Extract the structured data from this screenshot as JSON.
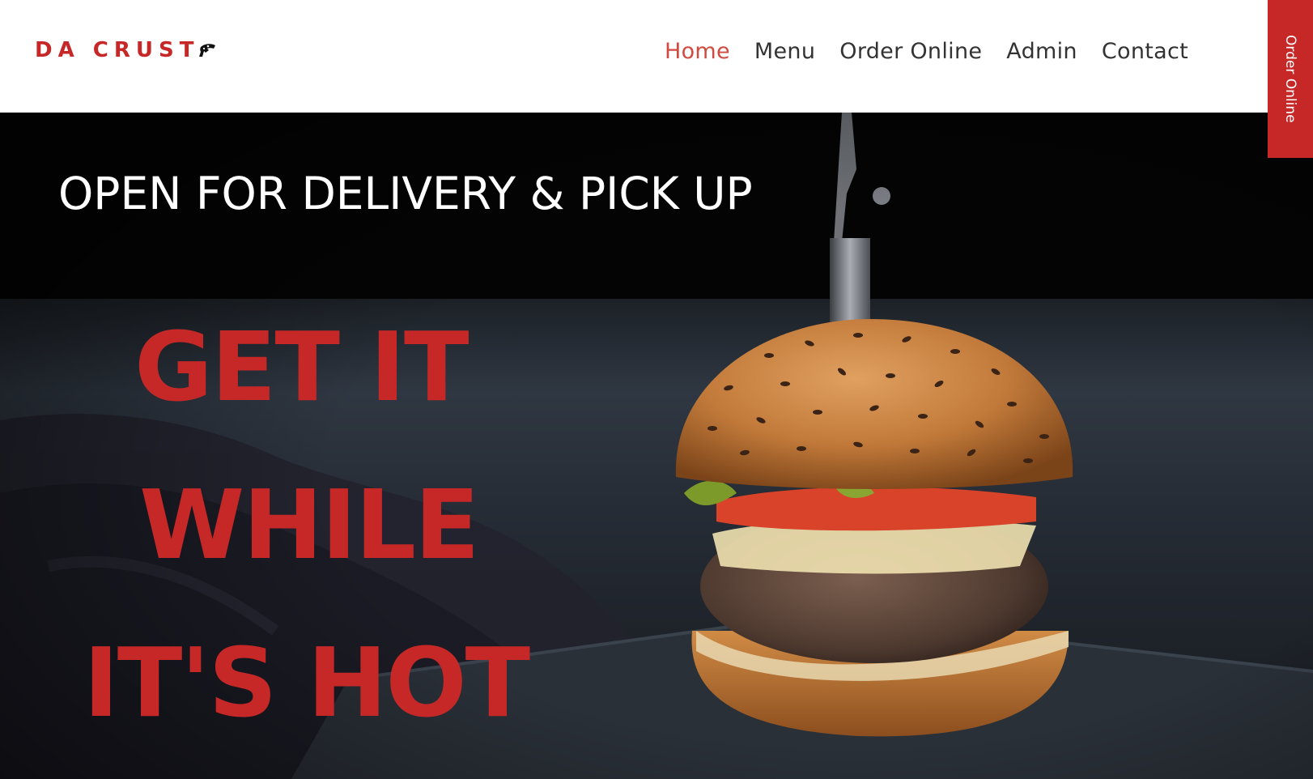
{
  "brand": {
    "name": "DA CRUST",
    "icon": "pizza-slice-icon",
    "color": "#c62828"
  },
  "nav": {
    "items": [
      {
        "label": "Home",
        "active": true
      },
      {
        "label": "Menu",
        "active": false
      },
      {
        "label": "Order Online",
        "active": false
      },
      {
        "label": "Admin",
        "active": false
      },
      {
        "label": "Contact",
        "active": false
      }
    ],
    "active_color": "#d14a3f"
  },
  "side_button": {
    "label": "Order Online"
  },
  "hero": {
    "tagline": "OPEN FOR DELIVERY & PICK UP",
    "headline": [
      "GET IT",
      "WHILE",
      "IT'S HOT"
    ],
    "image": "burger-with-knife-image",
    "headline_color": "#c62828"
  }
}
